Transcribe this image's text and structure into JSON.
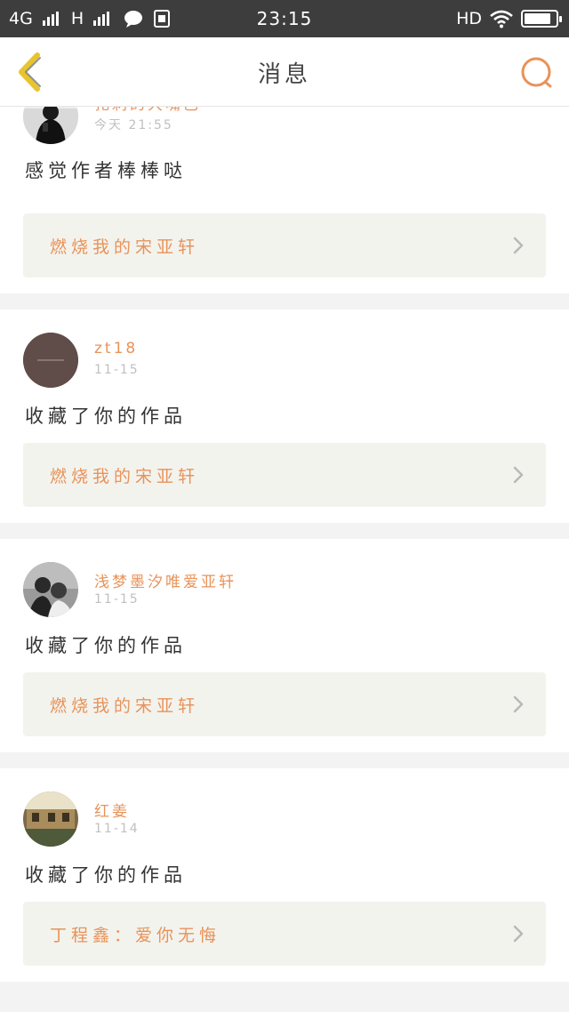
{
  "status_bar": {
    "network": "4G",
    "network2": "H",
    "time": "23:15",
    "hd": "HD",
    "battery_level": 0.85
  },
  "nav": {
    "title": "消息",
    "back_icon": "chevron-left-icon",
    "search_icon": "search-icon"
  },
  "colors": {
    "accent": "#e8935a",
    "back_icon": "#e8c42e",
    "card_bg": "#ffffff",
    "link_bg": "#f3f3ee",
    "page_bg": "#f3f3f3"
  },
  "notifications": [
    {
      "username": "扎刺的大嘴巴",
      "time": "今天 21:55",
      "message": "感觉作者棒棒哒",
      "work": "燃烧我的宋亚轩"
    },
    {
      "username": "zt18",
      "time": "11-15",
      "message": "收藏了你的作品",
      "work": "燃烧我的宋亚轩"
    },
    {
      "username": "浅梦墨汐唯爱亚轩",
      "time": "11-15",
      "message": "收藏了你的作品",
      "work": "燃烧我的宋亚轩"
    },
    {
      "username": "红姜",
      "time": "11-14",
      "message": "收藏了你的作品",
      "work": "丁程鑫：爱你无悔"
    }
  ]
}
